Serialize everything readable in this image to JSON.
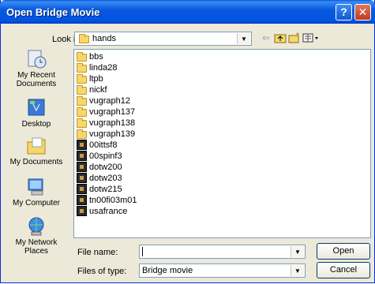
{
  "window": {
    "title": "Open Bridge Movie",
    "help_label": "?",
    "close_label": "✕"
  },
  "lookin": {
    "label": "Look in:",
    "value": "hands",
    "arrow": "▼"
  },
  "places": [
    {
      "label": "My Recent Documents",
      "icon": "recent-documents-icon"
    },
    {
      "label": "Desktop",
      "icon": "desktop-icon"
    },
    {
      "label": "My Documents",
      "icon": "my-documents-icon"
    },
    {
      "label": "My Computer",
      "icon": "my-computer-icon"
    },
    {
      "label": "My Network Places",
      "icon": "network-places-icon"
    }
  ],
  "files": [
    {
      "name": "bbs",
      "type": "folder"
    },
    {
      "name": "linda28",
      "type": "folder"
    },
    {
      "name": "ltpb",
      "type": "folder"
    },
    {
      "name": "nickf",
      "type": "folder"
    },
    {
      "name": "vugraph12",
      "type": "folder"
    },
    {
      "name": "vugraph137",
      "type": "folder"
    },
    {
      "name": "vugraph138",
      "type": "folder"
    },
    {
      "name": "vugraph139",
      "type": "folder"
    },
    {
      "name": "00ittsf8",
      "type": "movie"
    },
    {
      "name": "00spinf3",
      "type": "movie"
    },
    {
      "name": "dotw200",
      "type": "movie"
    },
    {
      "name": "dotw203",
      "type": "movie"
    },
    {
      "name": "dotw215",
      "type": "movie"
    },
    {
      "name": "tn00fi03m01",
      "type": "movie"
    },
    {
      "name": "usafrance",
      "type": "movie"
    }
  ],
  "filename": {
    "label": "File name:",
    "value": "",
    "arrow": "▼"
  },
  "filetype": {
    "label": "Files of type:",
    "value": "Bridge movie",
    "arrow": "▼"
  },
  "buttons": {
    "open": "Open",
    "cancel": "Cancel"
  }
}
